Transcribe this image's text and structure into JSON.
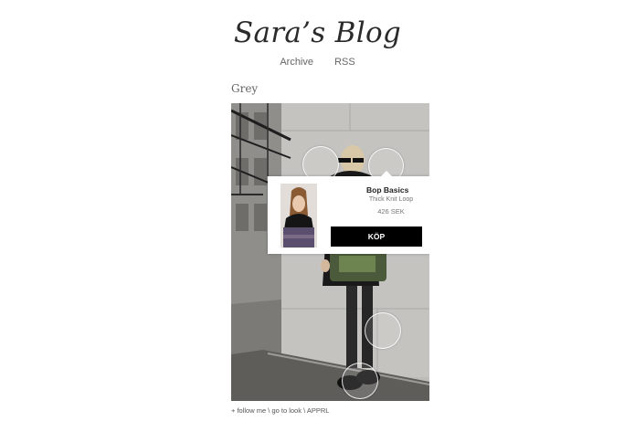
{
  "blog": {
    "title": "Sara’s Blog"
  },
  "nav": {
    "archive": "Archive",
    "rss": "RSS"
  },
  "post": {
    "title": "Grey"
  },
  "popup": {
    "brand": "Bop Basics",
    "product_name": "Thick Knit Loop",
    "price": "426 SEK",
    "buy_label": "KÖP"
  },
  "footer": {
    "follow": "+ follow me",
    "look": "go to look",
    "apprl": "APPRL",
    "separator": "\\"
  }
}
